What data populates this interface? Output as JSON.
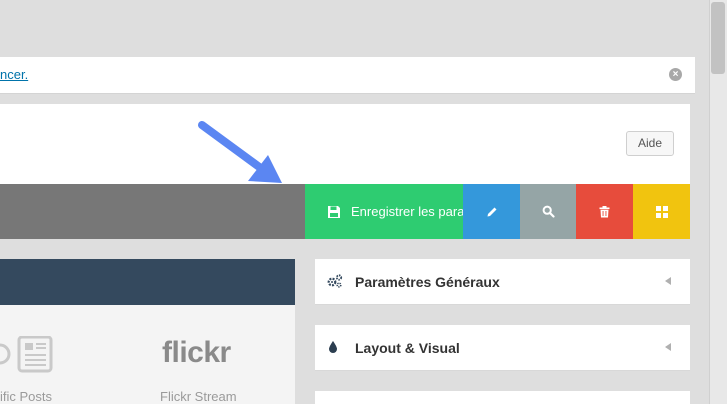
{
  "notice": {
    "link_text": "ncer."
  },
  "header": {
    "help_label": "Aide"
  },
  "toolbar": {
    "save_label": "Enregistrer les paramètres",
    "colors": {
      "save": "#2ecc71",
      "edit": "#3498db",
      "search": "#95a5a6",
      "delete": "#e74c3c",
      "layout": "#f1c40f"
    }
  },
  "widgets": {
    "items": [
      {
        "label": "ific Posts"
      },
      {
        "label": "Flickr Stream",
        "logo": "flickr"
      }
    ]
  },
  "accordion": {
    "items": [
      {
        "title": "Paramètres Généraux",
        "icon": "gears-icon"
      },
      {
        "title": "Layout & Visual",
        "icon": "droplet-icon"
      }
    ]
  }
}
